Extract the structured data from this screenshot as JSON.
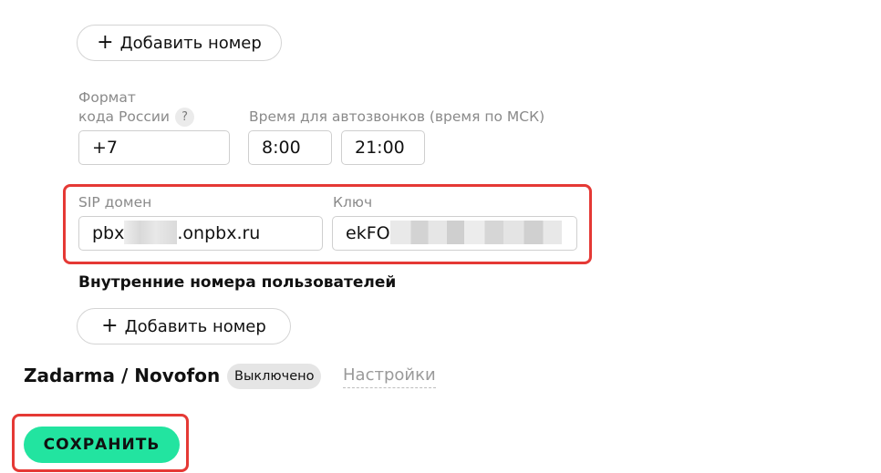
{
  "top_add_button": {
    "icon": "plus-icon",
    "label": "Добавить номер"
  },
  "format": {
    "label_line1": "Формат",
    "label_line2": "кода России",
    "help": "?",
    "value": "+7"
  },
  "autocall": {
    "label": "Время для автозвонков (время по МСК)",
    "from": "8:00",
    "to": "21:00"
  },
  "sip": {
    "domain_label": "SIP домен",
    "domain_prefix": "pbx",
    "domain_suffix": ".onpbx.ru",
    "key_label": "Ключ",
    "key_prefix": "ekFO"
  },
  "internal": {
    "heading": "Внутренние номера пользователей",
    "add_button_icon": "plus-icon",
    "add_button_label": "Добавить номер"
  },
  "provider": {
    "name": "Zadarma / Novofon",
    "status": "Выключено",
    "settings_link": "Настройки"
  },
  "save_button": {
    "label": "СОХРАНИТЬ"
  },
  "colors": {
    "highlight_border": "#e53935",
    "save_button_bg": "#22e4a0",
    "badge_bg": "#e5e5e5"
  }
}
